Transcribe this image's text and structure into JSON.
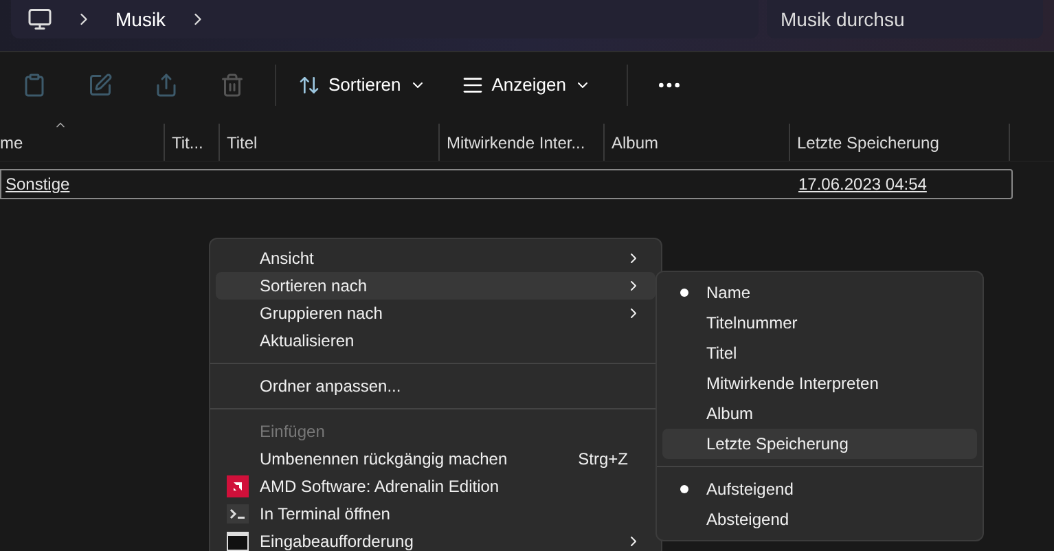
{
  "breadcrumb": {
    "items": [
      {
        "label": "Musik"
      }
    ]
  },
  "search": {
    "placeholder": "Musik durchsu"
  },
  "toolbar": {
    "icons": [
      {
        "kind": "paste",
        "disabled": true
      },
      {
        "kind": "rename",
        "disabled": true
      },
      {
        "kind": "share",
        "disabled": true
      },
      {
        "kind": "delete",
        "disabled": true
      }
    ],
    "buttons": [
      {
        "kind": "sort",
        "label": "Sortieren"
      },
      {
        "kind": "view",
        "label": "Anzeigen"
      }
    ]
  },
  "table": {
    "columns": [
      {
        "label": "me",
        "sorted": true
      },
      {
        "label": "Tit..."
      },
      {
        "label": "Titel"
      },
      {
        "label": "Mitwirkende Inter..."
      },
      {
        "label": "Album"
      },
      {
        "label": "Letzte Speicherung"
      }
    ],
    "rows": [
      {
        "name": "Sonstige",
        "date": "17.06.2023 04:54",
        "selected": true
      }
    ]
  },
  "context_menu": {
    "items": [
      {
        "kind": "item",
        "label": "Ansicht",
        "submenu": true,
        "highlighted": false
      },
      {
        "kind": "item",
        "label": "Sortieren nach",
        "submenu": true,
        "highlighted": true
      },
      {
        "kind": "item",
        "label": "Gruppieren nach",
        "submenu": true,
        "highlighted": false
      },
      {
        "kind": "item",
        "label": "Aktualisieren",
        "highlighted": false
      },
      {
        "kind": "separator"
      },
      {
        "kind": "item",
        "label": "Ordner anpassen...",
        "highlighted": false
      },
      {
        "kind": "separator"
      },
      {
        "kind": "item",
        "label": "Einfügen",
        "disabled": true,
        "highlighted": false
      },
      {
        "kind": "item",
        "label": "Umbenennen rückgängig machen",
        "shortcut": "Strg+Z",
        "highlighted": false
      },
      {
        "kind": "amd_app",
        "label": "AMD Software: Adrenalin Edition",
        "highlighted": false
      },
      {
        "kind": "terminal",
        "label": "In Terminal öffnen",
        "highlighted": false
      },
      {
        "kind": "console",
        "label": "Eingabeaufforderung",
        "submenu": true,
        "highlighted": false
      }
    ]
  },
  "sort_submenu": {
    "items": [
      {
        "kind": "radio",
        "label": "Name",
        "selected": true,
        "highlighted": false
      },
      {
        "kind": "radio",
        "label": "Titelnummer",
        "selected": false,
        "highlighted": false
      },
      {
        "kind": "radio",
        "label": "Titel",
        "selected": false,
        "highlighted": false
      },
      {
        "kind": "radio",
        "label": "Mitwirkende Interpreten",
        "selected": false,
        "highlighted": false
      },
      {
        "kind": "radio",
        "label": "Album",
        "selected": false,
        "highlighted": false
      },
      {
        "kind": "radio",
        "label": "Letzte Speicherung",
        "selected": false,
        "highlighted": true
      },
      {
        "kind": "separator"
      },
      {
        "kind": "radio",
        "label": "Aufsteigend",
        "selected": true,
        "highlighted": false
      },
      {
        "kind": "radio",
        "label": "Absteigend",
        "selected": false,
        "highlighted": false
      }
    ]
  }
}
